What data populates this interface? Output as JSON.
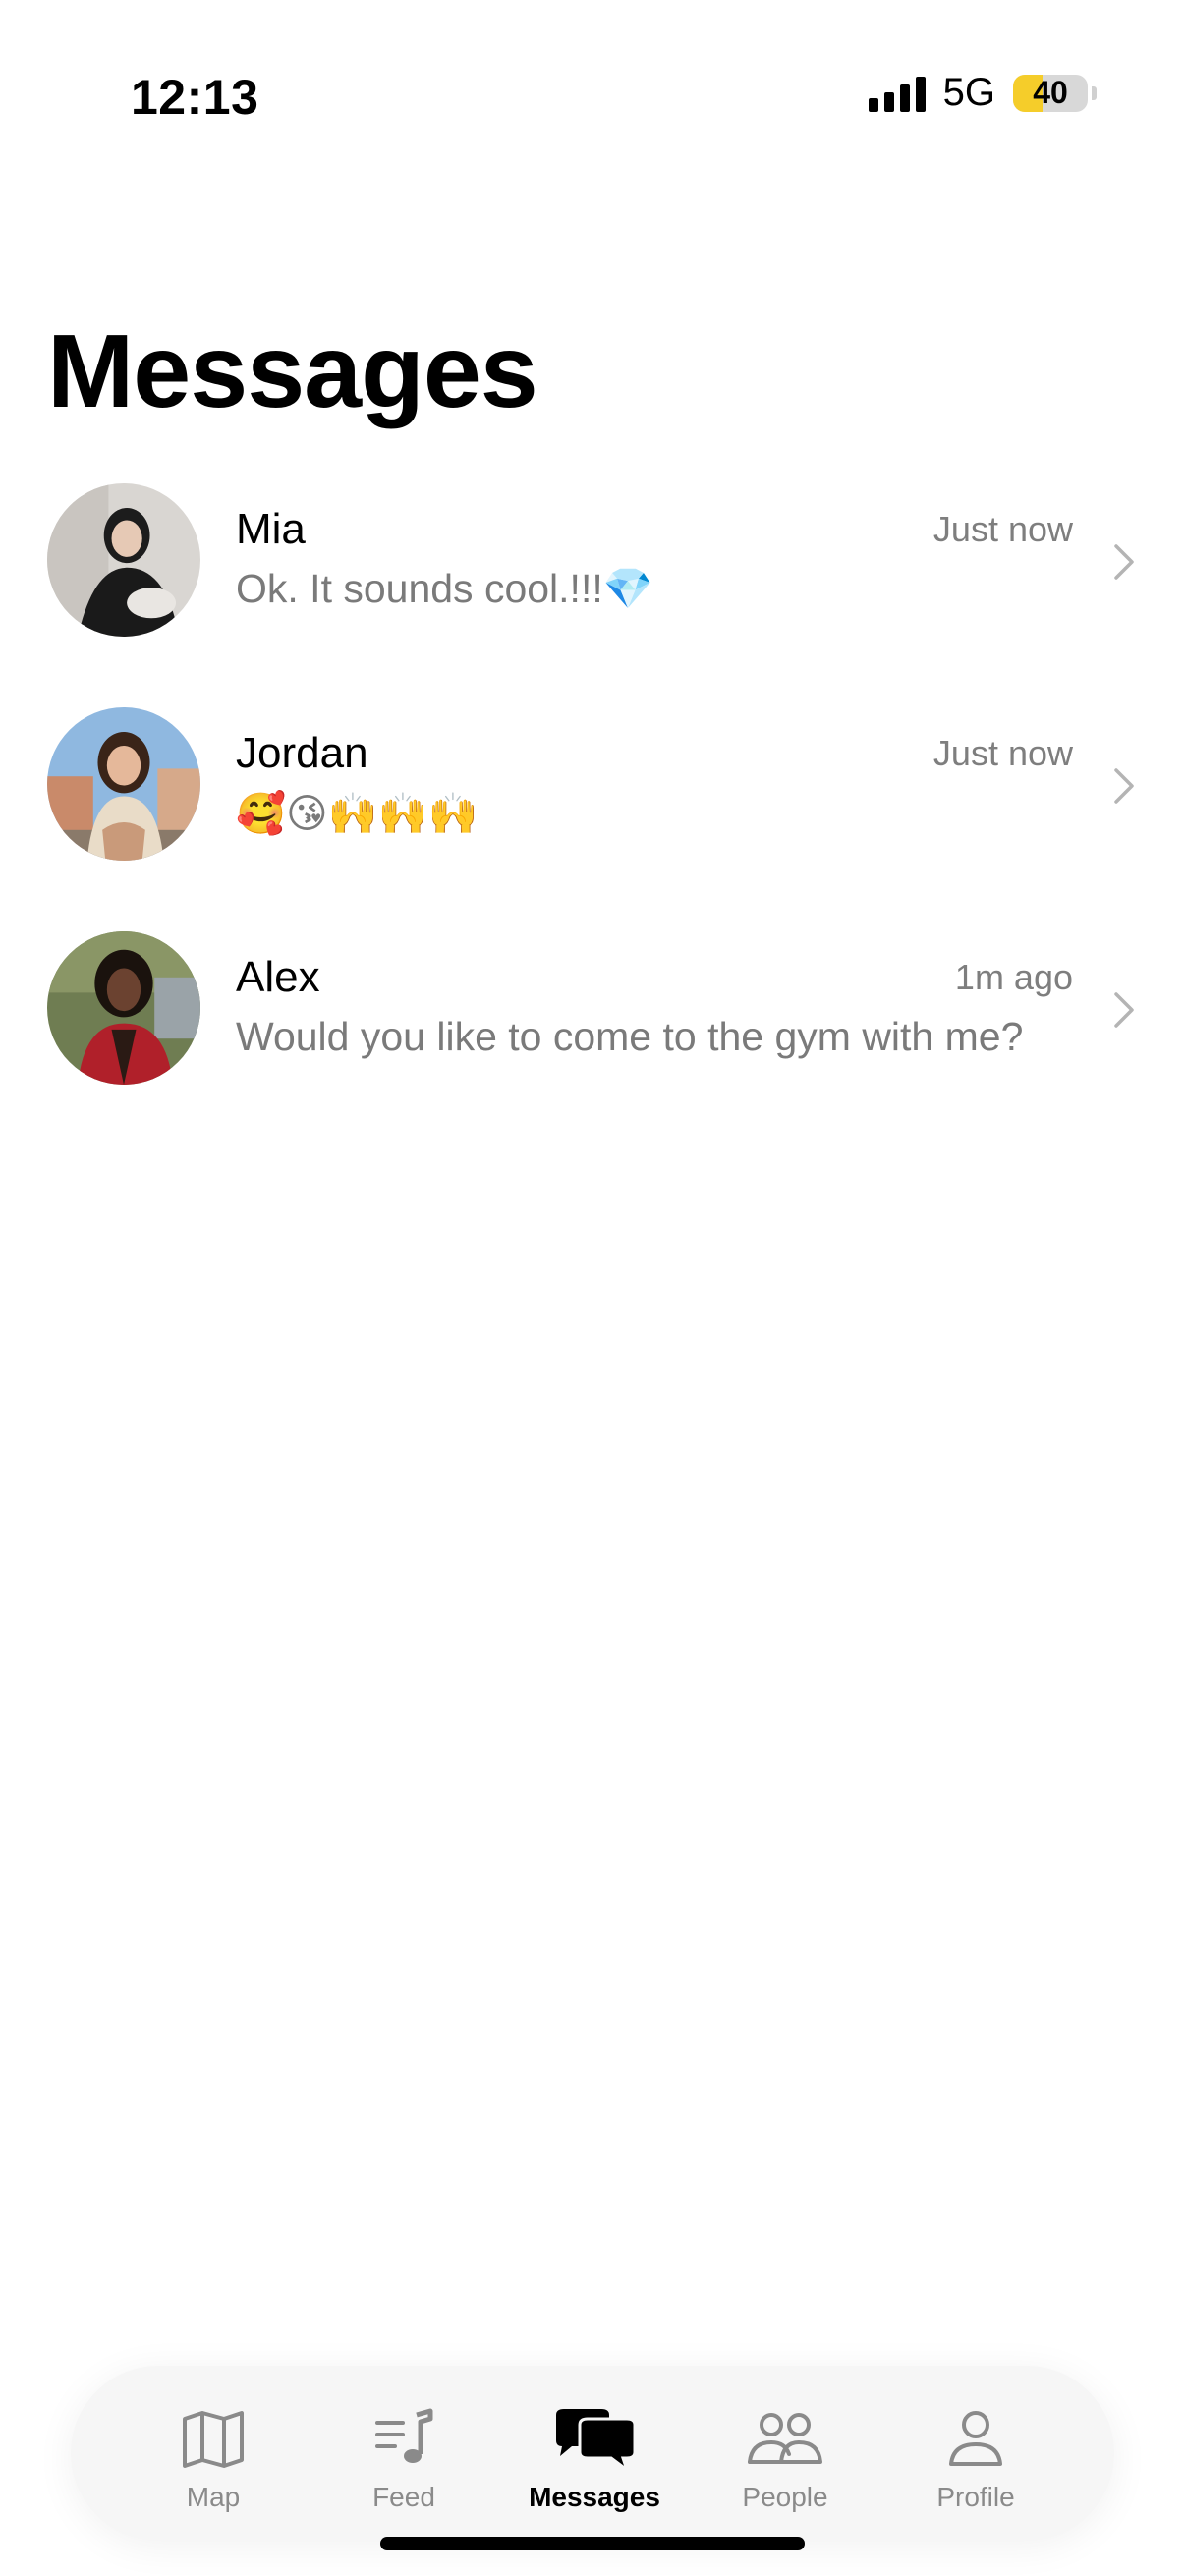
{
  "status_bar": {
    "time": "12:13",
    "network": "5G",
    "battery_percent": "40"
  },
  "page": {
    "title": "Messages"
  },
  "conversations": [
    {
      "name": "Mia",
      "preview": "Ok. It sounds cool.!!!💎",
      "time": "Just now"
    },
    {
      "name": "Jordan",
      "preview": "🥰😘🙌🙌🙌",
      "time": "Just now"
    },
    {
      "name": "Alex",
      "preview": "Would you like to come to the gym with me?",
      "time": "1m ago"
    }
  ],
  "tabbar": {
    "tabs": [
      {
        "label": "Map",
        "icon": "map-icon"
      },
      {
        "label": "Feed",
        "icon": "music-list-icon"
      },
      {
        "label": "Messages",
        "icon": "chat-bubbles-icon",
        "active": true
      },
      {
        "label": "People",
        "icon": "people-icon"
      },
      {
        "label": "Profile",
        "icon": "person-icon"
      }
    ]
  },
  "colors": {
    "battery_fill": "#f5cd2a",
    "secondary_text": "#7a7a7a",
    "tab_inactive": "#8a8a8a"
  }
}
